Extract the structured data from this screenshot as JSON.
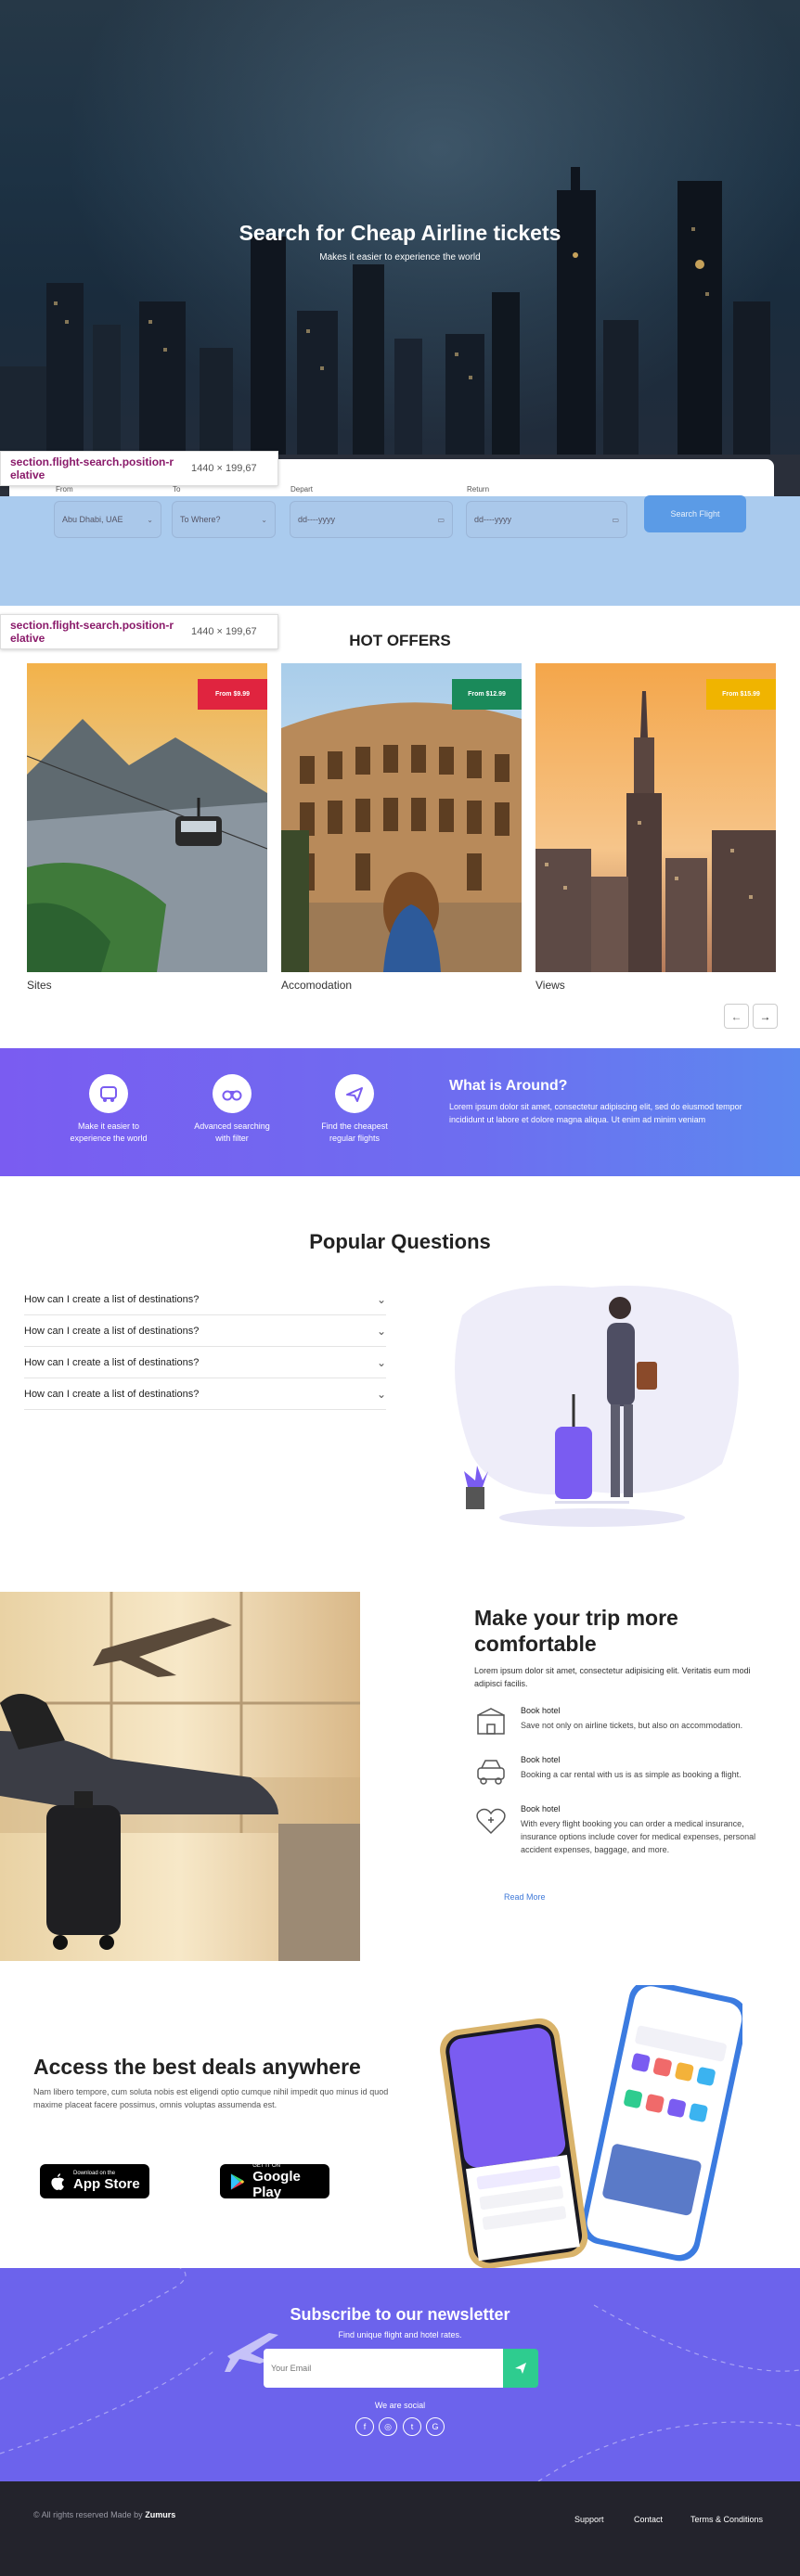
{
  "hero": {
    "title": "Search for Cheap Airline tickets",
    "subtitle": "Makes it easier to experience the world"
  },
  "inspector": {
    "selector_line1": "section.flight-search.position-r",
    "selector_line2": "elative",
    "dimensions": "1440 × 199,67"
  },
  "search": {
    "labels": [
      "From",
      "To",
      "Depart",
      "Return"
    ],
    "from_value": "Abu Dhabi, UAE",
    "to_placeholder": "To Where?",
    "depart_placeholder": "dd----yyyy",
    "return_placeholder": "dd----yyyy",
    "button_label": "Search Flight",
    "colors": {
      "band": "#aacbee",
      "button": "#5b9be6"
    }
  },
  "offers": {
    "title": "HOT OFFERS",
    "items": [
      {
        "badge": "From $9.99",
        "caption": "Sites",
        "badge_color": "#e0243f"
      },
      {
        "badge": "From $12.99",
        "caption": "Accomodation",
        "badge_color": "#1a8a5a"
      },
      {
        "badge": "From $15.99",
        "caption": "Views",
        "badge_color": "#f0b400"
      }
    ],
    "prev_icon": "arrow-left-icon",
    "next_icon": "arrow-right-icon"
  },
  "features": {
    "items": [
      {
        "icon": "bus-icon",
        "label_line1": "Make it easier to",
        "label_line2": "experience the world"
      },
      {
        "icon": "binoculars-icon",
        "label_line1": "Advanced searching",
        "label_line2": "with filter"
      },
      {
        "icon": "plane-icon",
        "label_line1": "Find the cheapest",
        "label_line2": "regular flights"
      }
    ],
    "around_title": "What is Around?",
    "around_text": "Lorem ipsum dolor sit amet, consectetur adipiscing elit, sed do eiusmod tempor incididunt ut labore et dolore magna aliqua. Ut enim ad minim veniam"
  },
  "faq": {
    "title": "Popular Questions",
    "items": [
      "How can I create a list of destinations?",
      "How can I create a list of destinations?",
      "How can I create a list of destinations?",
      "How can I create a list of destinations?"
    ]
  },
  "trip": {
    "title": "Make your trip more comfortable",
    "description": "Lorem ipsum dolor sit amet, consectetur adipisicing elit. Veritatis eum modi adipisci facilis.",
    "features": [
      {
        "icon": "hotel-icon",
        "title": "Book hotel",
        "text": "Save not only on airline tickets, but also on accommodation."
      },
      {
        "icon": "car-rental-icon",
        "title": "Book hotel",
        "text": "Booking a car rental with us is as simple as booking a flight."
      },
      {
        "icon": "heart-medical-icon",
        "title": "Book hotel",
        "text": "With every flight booking you can order a medical insurance, insurance options include cover for medical expenses, personal accident expenses, baggage, and more."
      }
    ],
    "read_more": "Read More"
  },
  "app": {
    "title": "Access the best deals anywhere",
    "description": "Nam libero tempore, cum soluta nobis est eligendi optio cumque nihil impedit quo minus id quod maxime placeat facere possimus, omnis voluptas assumenda est.",
    "app_store_small": "Download on the",
    "app_store_big": "App Store",
    "google_small": "GET IT ON",
    "google_big": "Google Play"
  },
  "newsletter": {
    "title": "Subscribe to our newsletter",
    "subtitle": "Find unique flight and hotel rates.",
    "input_placeholder": "Your Email",
    "social_label": "We are social",
    "socials": [
      {
        "icon": "facebook-icon",
        "glyph": "f"
      },
      {
        "icon": "instagram-icon",
        "glyph": "◎"
      },
      {
        "icon": "twitter-icon",
        "glyph": "t"
      },
      {
        "icon": "google-icon",
        "glyph": "G"
      }
    ],
    "color": "#6c63ec"
  },
  "footer": {
    "copyright_prefix": "© All rights reserved Made by",
    "brand": "Zumurs",
    "links": [
      "Support",
      "Contact",
      "Terms & Conditions"
    ]
  }
}
